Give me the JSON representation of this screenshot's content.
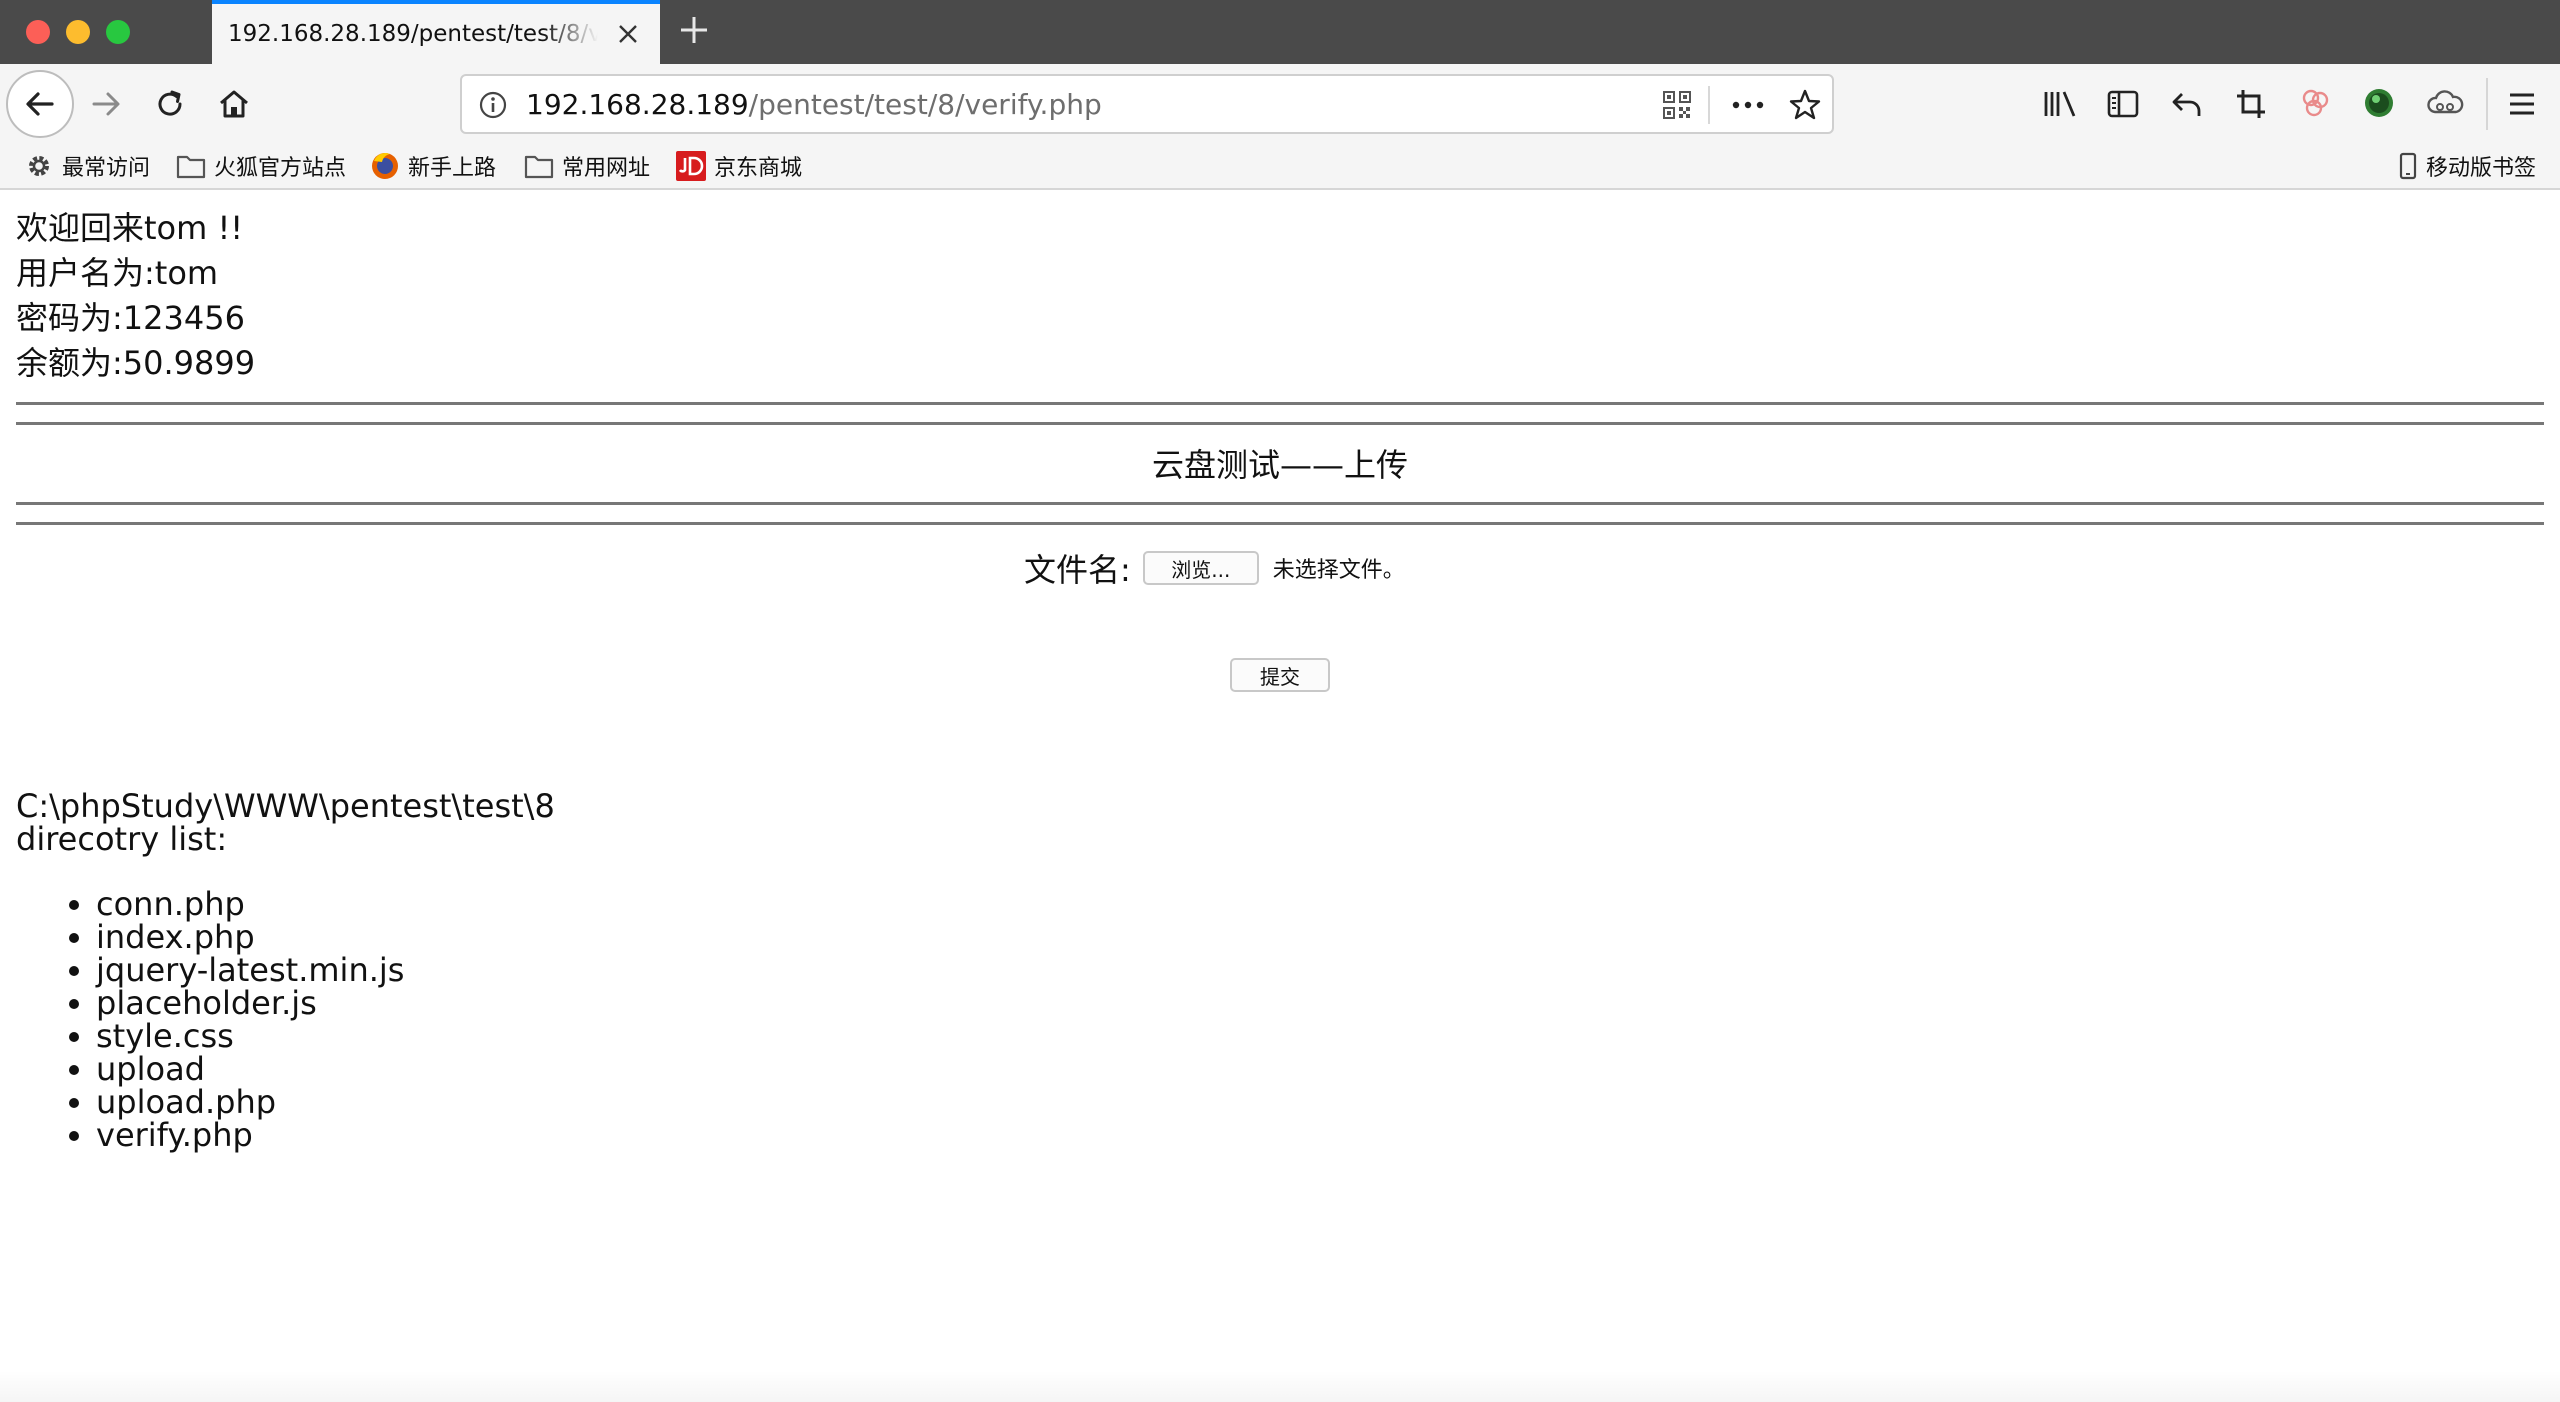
{
  "tab": {
    "title": "192.168.28.189/pentest/test/8/verify.php"
  },
  "urlbar": {
    "host": "192.168.28.189",
    "path": "/pentest/test/8/verify.php"
  },
  "bookmarks": {
    "items": [
      {
        "label": "最常访问",
        "icon": "gear-icon"
      },
      {
        "label": "火狐官方站点",
        "icon": "folder-icon"
      },
      {
        "label": "新手上路",
        "icon": "firefox-icon"
      },
      {
        "label": "常用网址",
        "icon": "folder-icon"
      },
      {
        "label": "京东商城",
        "icon": "jd-icon"
      }
    ],
    "mobile": {
      "label": "移动版书签",
      "icon": "mobile-icon"
    }
  },
  "page": {
    "welcome": "欢迎回来tom !!",
    "username": "用户名为:tom",
    "password": "密码为:123456",
    "balance": "余额为:50.9899",
    "upload_title": "云盘测试——上传",
    "file_label": "文件名:",
    "browse_label": "浏览...",
    "file_status": "未选择文件。",
    "submit_label": "提交",
    "path": "C:\\phpStudy\\WWW\\pentest\\test\\8",
    "list_heading": "direcotry list:",
    "files": [
      "conn.php",
      "index.php",
      "jquery-latest.min.js",
      "placeholder.js",
      "style.css",
      "upload",
      "upload.php",
      "verify.php"
    ]
  },
  "colors": {
    "tabstrip": "#4a4a4a",
    "toolbar": "#f5f5f5",
    "accent": "#0a84ff",
    "close": "#fc5f57",
    "minimize": "#fdbc2e",
    "zoom": "#28c840"
  }
}
